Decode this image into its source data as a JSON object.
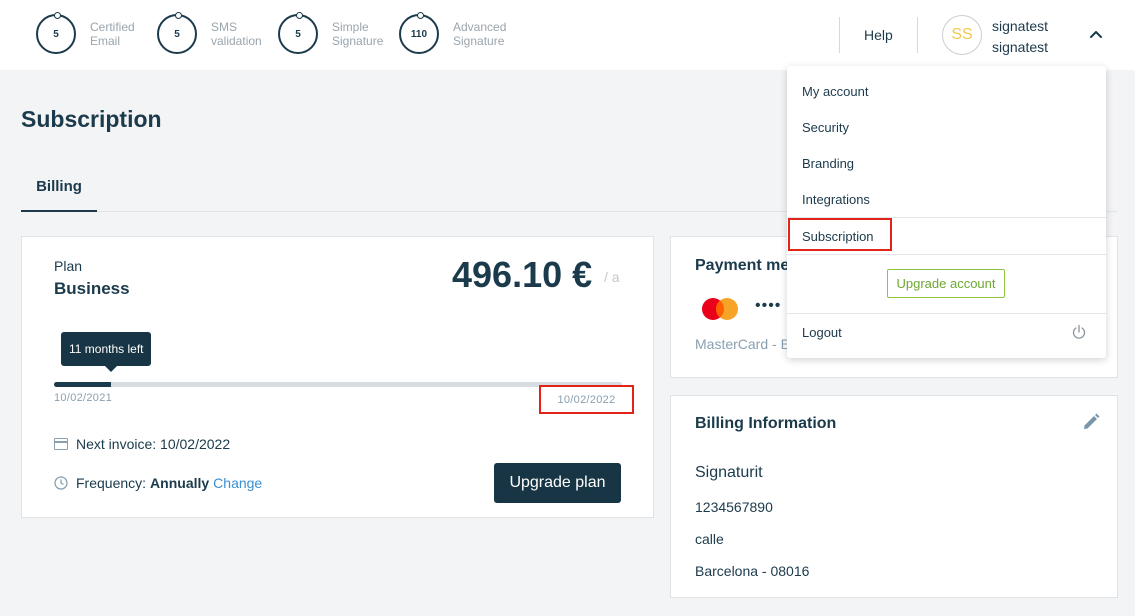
{
  "counters": [
    {
      "value": "5",
      "label1": "Certified",
      "label2": "Email"
    },
    {
      "value": "5",
      "label1": "SMS",
      "label2": "validation"
    },
    {
      "value": "5",
      "label1": "Simple",
      "label2": "Signature"
    },
    {
      "value": "110",
      "label1": "Advanced",
      "label2": "Signature"
    }
  ],
  "header": {
    "help": "Help",
    "avatar_initials": "SS",
    "user_line1": "signatest",
    "user_line2": "signatest"
  },
  "page": {
    "title": "Subscription",
    "tab": "Billing"
  },
  "plan": {
    "label": "Plan",
    "name": "Business",
    "price": "496.10 €",
    "price_unit": "/ a",
    "tooltip": "11 months left",
    "progress": 0.1,
    "date_start": "10/02/2021",
    "date_end": "10/02/2022",
    "next_invoice": "Next invoice: 10/02/2022",
    "frequency_label": "Frequency:",
    "frequency_value": "Annually",
    "change_link": "Change",
    "upgrade_button": "Upgrade plan"
  },
  "payment": {
    "title": "Payment met",
    "dots": "••••",
    "card_desc": "MasterCard - E"
  },
  "billing": {
    "title": "Billing Information",
    "company": "Signaturit",
    "tax_id": "1234567890",
    "street": "calle",
    "city": "Barcelona - 08016"
  },
  "dropdown": {
    "items": [
      "My account",
      "Security",
      "Branding",
      "Integrations",
      "Subscription"
    ],
    "upgrade": "Upgrade account",
    "logout": "Logout"
  },
  "colors": {
    "primary": "#1b3a4b",
    "highlight_red": "#e2231a",
    "upgrade_green": "#8dc63f",
    "link_blue": "#3b8fd1"
  }
}
